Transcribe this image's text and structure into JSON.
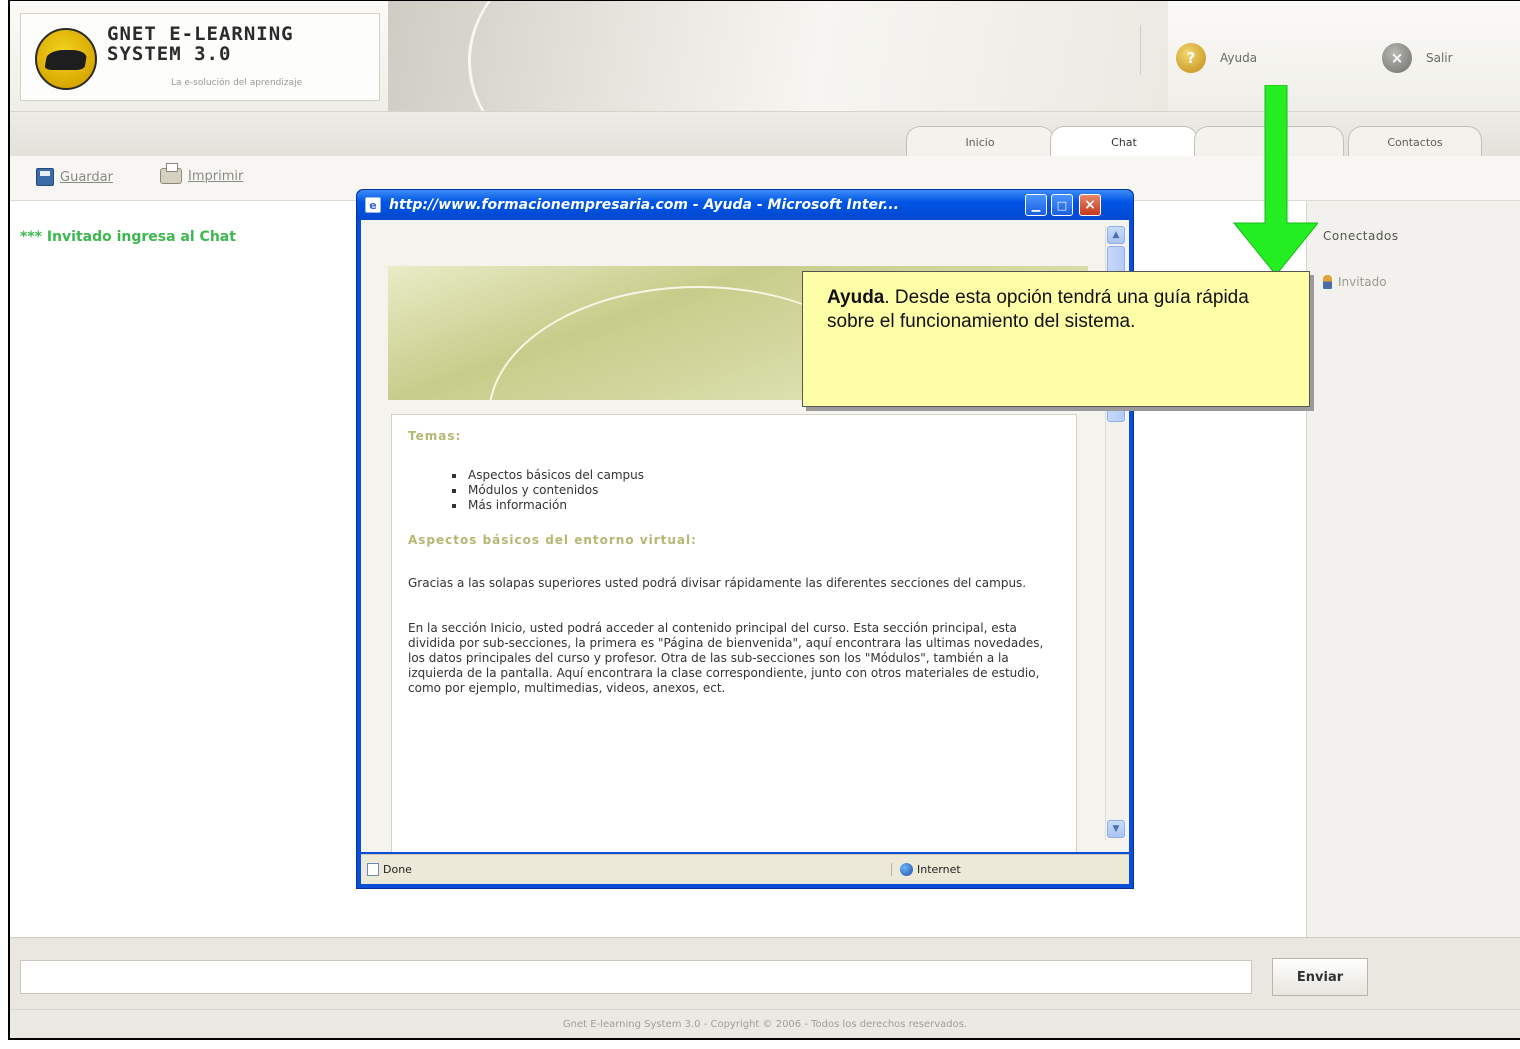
{
  "header": {
    "logo_line1": "GNET E-LEARNING",
    "logo_line2": "SYSTEM 3.0",
    "logo_tagline": "La e-solución del aprendizaje",
    "help_label": "Ayuda",
    "exit_label": "Salir"
  },
  "tabs": [
    {
      "label": "Inicio",
      "active": false
    },
    {
      "label": "Chat",
      "active": true
    },
    {
      "label": "",
      "active": false
    },
    {
      "label": "Contactos",
      "active": false
    }
  ],
  "toolbar": {
    "save_label": "Guardar",
    "print_label": "Imprimir"
  },
  "chat": {
    "messages": [
      "*** Invitado ingresa al Chat"
    ]
  },
  "users_panel": {
    "title": "Conectados",
    "users": [
      "Invitado"
    ]
  },
  "message_bar": {
    "input_value": "",
    "send_label": "Enviar"
  },
  "footer": {
    "text": "Gnet E-learning System 3.0 - Copyright © 2006 - Todos los derechos reservados."
  },
  "popup": {
    "title": "http://www.formacionempresaria.com - Ayuda - Microsoft Inter...",
    "content": {
      "topics_heading": "Temas:",
      "topics": [
        "Aspectos básicos del campus",
        "Módulos y contenidos",
        "Más información"
      ],
      "section_heading": "Aspectos básicos del entorno virtual:",
      "paragraph1": "Gracias a las solapas superiores usted podrá divisar rápidamente las diferentes secciones del campus.",
      "paragraph2": "En la sección Inicio, usted podrá acceder al contenido principal del curso. Esta sección principal, esta dividida por sub-secciones, la primera es \"Página de bienvenida\", aquí encontrara las ultimas novedades, los datos principales del curso y profesor. Otra de las sub-secciones son los \"Módulos\", también a la izquierda de la pantalla. Aquí encontrara la clase correspondiente, junto con otros materiales de estudio, como por ejemplo, multimedias, videos, anexos, ect."
    },
    "status_left": "Done",
    "status_right": "Internet"
  },
  "annotation": {
    "bold": "Ayuda",
    "text": ". Desde esta opción tendrá una guía rápida sobre el funcionamiento del sistema.",
    "arrow_color": "#22ee22"
  }
}
